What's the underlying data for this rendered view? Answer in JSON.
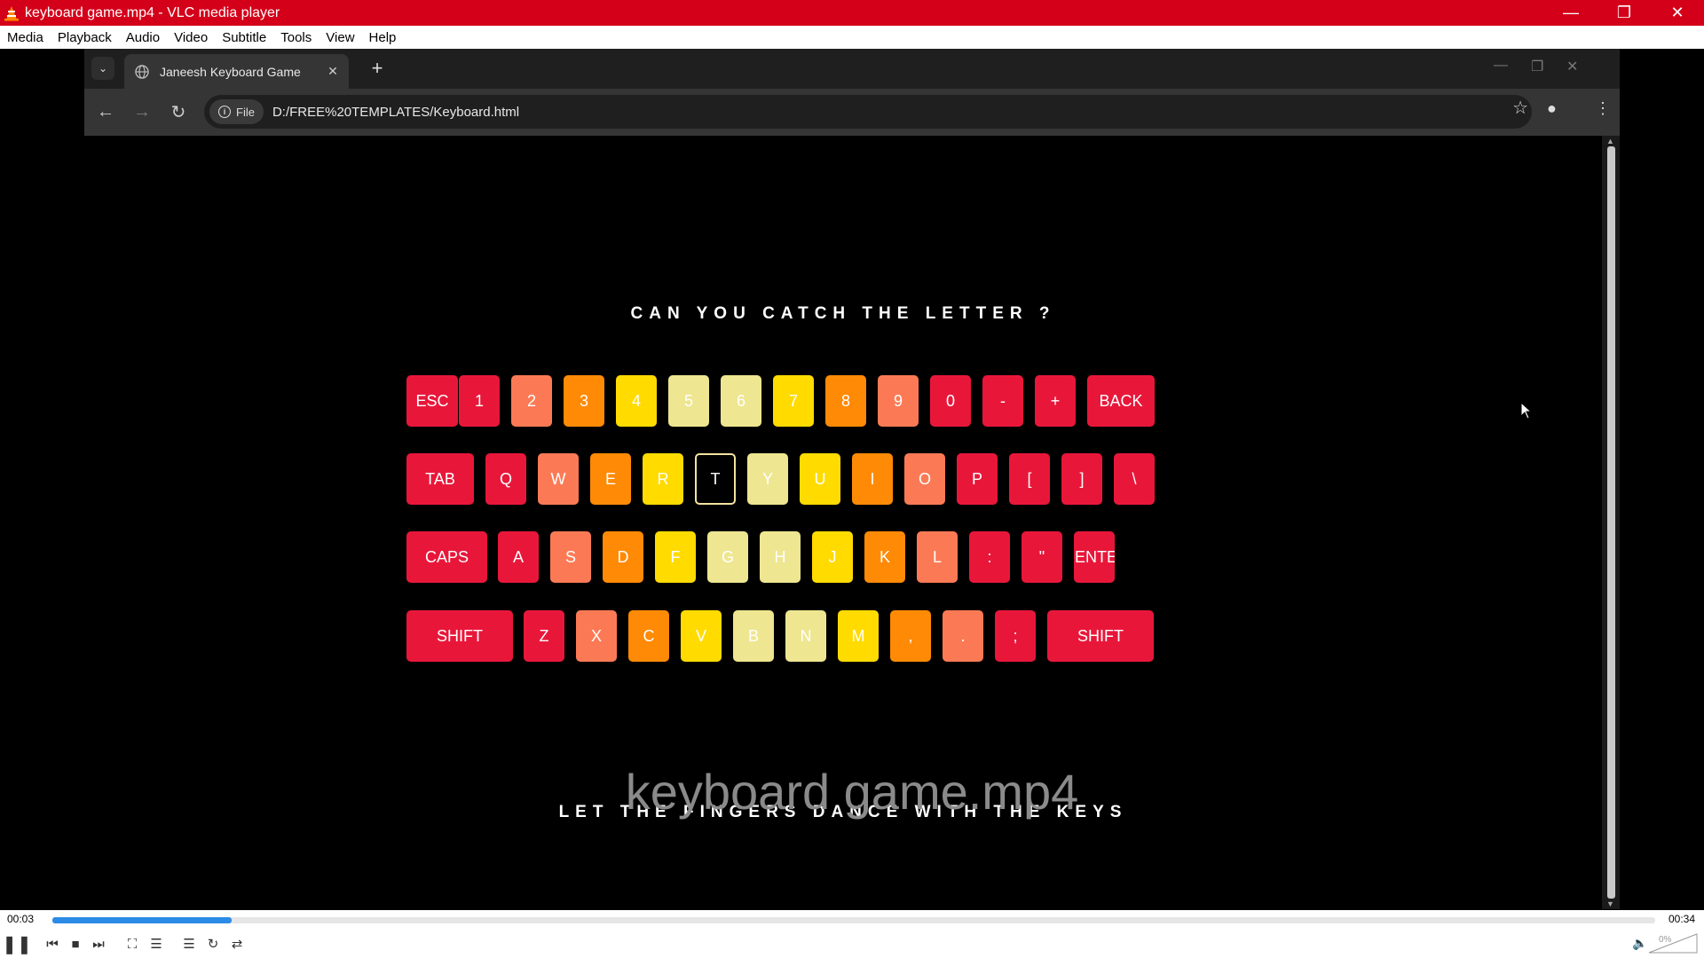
{
  "vlc": {
    "window_title": "keyboard game.mp4 - VLC media player",
    "menu": [
      "Media",
      "Playback",
      "Audio",
      "Video",
      "Subtitle",
      "Tools",
      "View",
      "Help"
    ],
    "time_elapsed": "00:03",
    "time_total": "00:34",
    "progress_fraction": 0.112,
    "volume": "0%",
    "watermark": "keyboard game.mp4"
  },
  "browser": {
    "tab_title": "Janeesh Keyboard Game",
    "chip_label": "File",
    "url": "D:/FREE%20TEMPLATES/Keyboard.html"
  },
  "game": {
    "title": "CAN YOU CATCH THE LETTER ?",
    "subtitle": "LET THE FINGERS DANCE WITH THE KEYS",
    "highlighted_key": "T",
    "palette": {
      "red": "#e8173a",
      "salmon": "#fb7a55",
      "orange": "#ff8a05",
      "yellow": "#ffdb00",
      "khaki": "#eee690"
    },
    "rows": [
      [
        {
          "label": "ESC",
          "color": "red"
        },
        {
          "label": "1",
          "color": "red"
        },
        {
          "label": "2",
          "color": "salmon"
        },
        {
          "label": "3",
          "color": "orange"
        },
        {
          "label": "4",
          "color": "yellow"
        },
        {
          "label": "5",
          "color": "khaki"
        },
        {
          "label": "6",
          "color": "khaki"
        },
        {
          "label": "7",
          "color": "yellow"
        },
        {
          "label": "8",
          "color": "orange"
        },
        {
          "label": "9",
          "color": "salmon"
        },
        {
          "label": "0",
          "color": "red"
        },
        {
          "label": "-",
          "color": "red"
        },
        {
          "label": "+",
          "color": "red"
        },
        {
          "label": "BACK",
          "color": "red"
        }
      ],
      [
        {
          "label": "TAB",
          "color": "red"
        },
        {
          "label": "Q",
          "color": "red"
        },
        {
          "label": "W",
          "color": "salmon"
        },
        {
          "label": "E",
          "color": "orange"
        },
        {
          "label": "R",
          "color": "yellow"
        },
        {
          "label": "T",
          "color": "outline"
        },
        {
          "label": "Y",
          "color": "khaki"
        },
        {
          "label": "U",
          "color": "yellow"
        },
        {
          "label": "I",
          "color": "orange"
        },
        {
          "label": "O",
          "color": "salmon"
        },
        {
          "label": "P",
          "color": "red"
        },
        {
          "label": "[",
          "color": "red"
        },
        {
          "label": "]",
          "color": "red"
        },
        {
          "label": "\\",
          "color": "red"
        }
      ],
      [
        {
          "label": "CAPS",
          "color": "red"
        },
        {
          "label": "A",
          "color": "red"
        },
        {
          "label": "S",
          "color": "salmon"
        },
        {
          "label": "D",
          "color": "orange"
        },
        {
          "label": "F",
          "color": "yellow"
        },
        {
          "label": "G",
          "color": "khaki"
        },
        {
          "label": "H",
          "color": "khaki"
        },
        {
          "label": "J",
          "color": "yellow"
        },
        {
          "label": "K",
          "color": "orange"
        },
        {
          "label": "L",
          "color": "salmon"
        },
        {
          "label": ":",
          "color": "red"
        },
        {
          "label": "\"",
          "color": "red"
        },
        {
          "label": "ENTEI",
          "color": "red"
        }
      ],
      [
        {
          "label": "SHIFT",
          "color": "red"
        },
        {
          "label": "Z",
          "color": "red"
        },
        {
          "label": "X",
          "color": "salmon"
        },
        {
          "label": "C",
          "color": "orange"
        },
        {
          "label": "V",
          "color": "yellow"
        },
        {
          "label": "B",
          "color": "khaki"
        },
        {
          "label": "N",
          "color": "khaki"
        },
        {
          "label": "M",
          "color": "yellow"
        },
        {
          "label": ",",
          "color": "orange"
        },
        {
          "label": ".",
          "color": "salmon"
        },
        {
          "label": ";",
          "color": "red"
        },
        {
          "label": "SHIFT",
          "color": "red"
        }
      ]
    ]
  }
}
